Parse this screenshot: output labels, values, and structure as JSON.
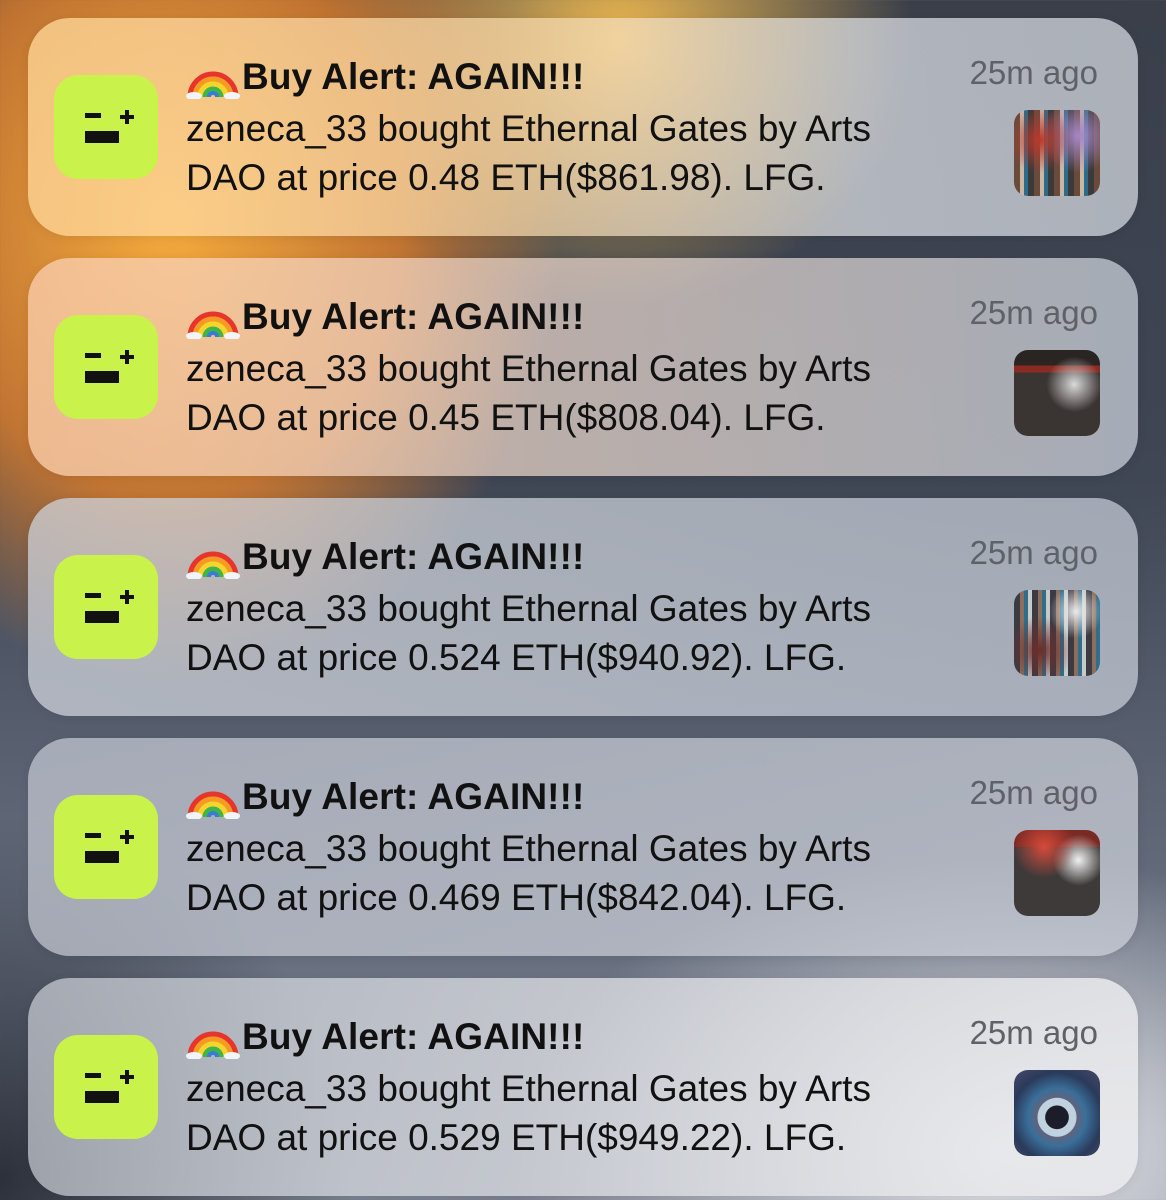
{
  "notifications": [
    {
      "title": "Buy Alert: AGAIN!!!",
      "time": "25m ago",
      "line1": "zeneca_33 bought Ethernal Gates by Arts",
      "line2": "DAO at price 0.48 ETH($861.98). LFG."
    },
    {
      "title": "Buy Alert: AGAIN!!!",
      "time": "25m ago",
      "line1": "zeneca_33 bought Ethernal Gates by Arts",
      "line2": "DAO at price 0.45 ETH($808.04). LFG."
    },
    {
      "title": "Buy Alert: AGAIN!!!",
      "time": "25m ago",
      "line1": "zeneca_33 bought Ethernal Gates by Arts",
      "line2": "DAO at price 0.524 ETH($940.92). LFG."
    },
    {
      "title": "Buy Alert: AGAIN!!!",
      "time": "25m ago",
      "line1": "zeneca_33 bought Ethernal Gates by Arts",
      "line2": "DAO at price 0.469 ETH($842.04). LFG."
    },
    {
      "title": "Buy Alert: AGAIN!!!",
      "time": "25m ago",
      "line1": "zeneca_33 bought Ethernal Gates by Arts",
      "line2": "DAO at price 0.529 ETH($949.22). LFG."
    }
  ],
  "icons": {
    "app": "app-icon",
    "emoji": "rainbow-emoji-icon",
    "thumbnail": "nft-thumbnail"
  },
  "colors": {
    "app_icon_bg": "#c9f24a",
    "app_icon_glyph": "#111111",
    "time_text": "#5f6168"
  }
}
